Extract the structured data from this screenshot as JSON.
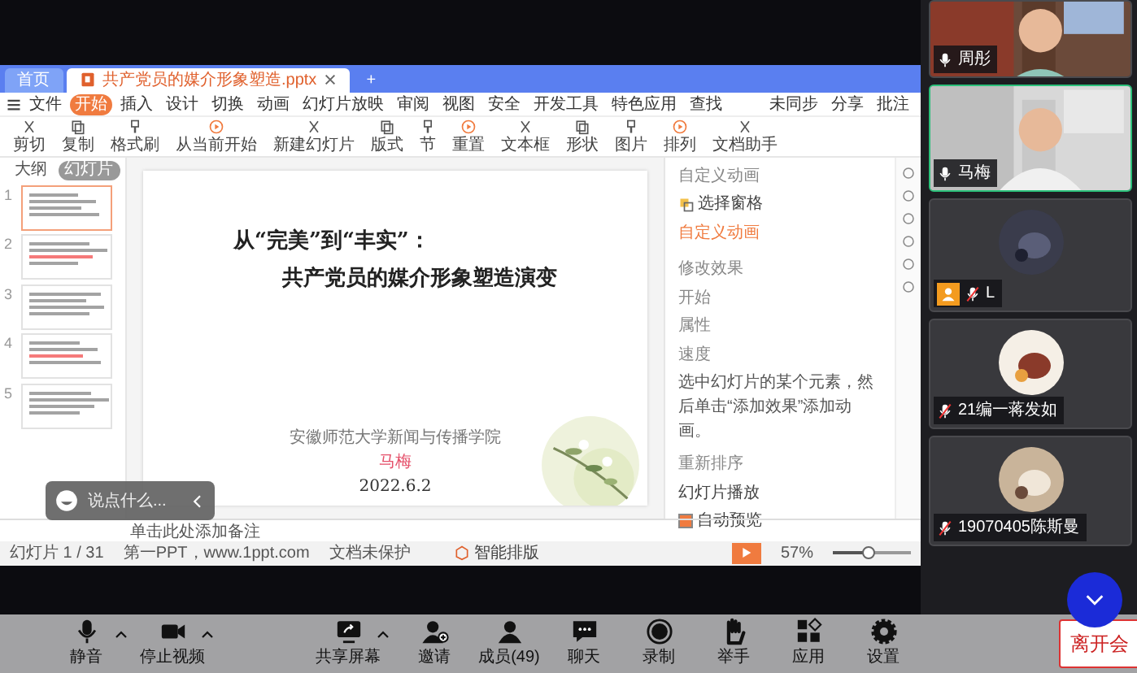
{
  "shared_screen": {
    "tabs": [
      {
        "label": "首页",
        "selected": false
      },
      {
        "label": "共产党员的媒介形象塑造.pptx",
        "selected": true
      }
    ],
    "new_tab": "+",
    "menu": [
      {
        "label": "文件",
        "selected": false
      },
      {
        "label": "开始",
        "selected": true
      },
      {
        "label": "插入",
        "selected": false
      },
      {
        "label": "设计",
        "selected": false
      },
      {
        "label": "切换",
        "selected": false
      },
      {
        "label": "动画",
        "selected": false
      },
      {
        "label": "幻灯片放映",
        "selected": false
      },
      {
        "label": "审阅",
        "selected": false
      },
      {
        "label": "视图",
        "selected": false
      },
      {
        "label": "安全",
        "selected": false
      },
      {
        "label": "开发工具",
        "selected": false
      },
      {
        "label": "特色应用",
        "selected": false
      },
      {
        "label": "查找",
        "selected": false
      }
    ],
    "quick_actions": [
      "未同步",
      "分享",
      "批注"
    ],
    "toolbar": [
      "剪切",
      "复制",
      "格式刷",
      "从当前开始",
      "新建幻灯片",
      "版式",
      "节",
      "重置",
      "文本框",
      "形状",
      "图片",
      "排列",
      "文档助手"
    ],
    "panel_tabs": [
      {
        "label": "大纲",
        "selected": false
      },
      {
        "label": "幻灯片",
        "selected": true
      }
    ],
    "thumbnails": [
      {
        "number": "1",
        "selected": true
      },
      {
        "number": "2",
        "selected": false
      },
      {
        "number": "3",
        "selected": false
      },
      {
        "number": "4",
        "selected": false
      },
      {
        "number": "5",
        "selected": false
      }
    ],
    "slide": {
      "title_lines": [
        "从“完美”到“丰实”：",
        "共产党员的媒介形象塑造演变"
      ],
      "institution": "安徽师范大学新闻与传播学院",
      "author": "马梅",
      "date": "2022.6.2"
    },
    "animation_pane": {
      "title": "自定义动画",
      "select_pane": "选择窗格",
      "heading": "自定义动画",
      "section": "修改效果",
      "fields": [
        "开始",
        "属性",
        "速度"
      ],
      "hint": "选中幻灯片的某个元素，然后单击“添加效果”添加动画。",
      "reorder": "重新排序",
      "play": "幻灯片播放",
      "auto_preview": {
        "label": "自动预览",
        "checked": true
      }
    },
    "notes_placeholder": "单击此处添加备注",
    "status_bar": {
      "slide_count": "幻灯片 1 / 31",
      "theme": "第一PPT，www.1ppt.com",
      "protection": "文档未保护",
      "smart_layout": "智能排版",
      "zoom": "57%",
      "zoom_slider": {
        "level": 0.45
      }
    }
  },
  "chat_input": {
    "placeholder": "说点什么..."
  },
  "participants": [
    {
      "name": "周彤",
      "kind": "video",
      "muted": false,
      "speaking": false,
      "host": false
    },
    {
      "name": "马梅",
      "kind": "video",
      "muted": false,
      "speaking": true,
      "host": false
    },
    {
      "name": "L",
      "kind": "avatar",
      "muted": true,
      "speaking": false,
      "host": true
    },
    {
      "name": "21编一蒋发如",
      "kind": "avatar",
      "muted": true,
      "speaking": false,
      "host": false
    },
    {
      "name": "19070405陈斯曼",
      "kind": "avatar",
      "muted": true,
      "speaking": false,
      "host": false
    }
  ],
  "meeting_toolbar": [
    {
      "label": "静音",
      "kind": "mic",
      "has_menu": true
    },
    {
      "label": "停止视频",
      "kind": "camera",
      "has_menu": true
    },
    {
      "label": "共享屏幕",
      "kind": "share",
      "has_menu": true
    },
    {
      "label": "邀请",
      "kind": "invite",
      "has_menu": false
    },
    {
      "label": "成员(49)",
      "kind": "members",
      "has_menu": false
    },
    {
      "label": "聊天",
      "kind": "chat",
      "has_menu": false
    },
    {
      "label": "录制",
      "kind": "record",
      "has_menu": false
    },
    {
      "label": "举手",
      "kind": "hand",
      "has_menu": false
    },
    {
      "label": "应用",
      "kind": "apps",
      "has_menu": false
    },
    {
      "label": "设置",
      "kind": "settings",
      "has_menu": false
    }
  ],
  "leave_button": "离开会"
}
